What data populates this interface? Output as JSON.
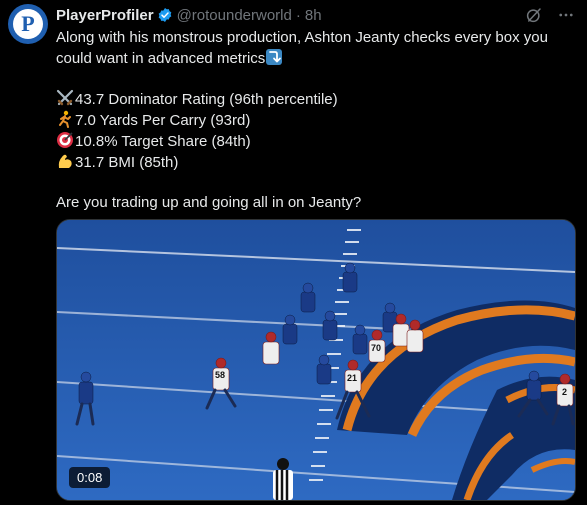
{
  "account": {
    "display_name": "PlayerProfiler",
    "handle": "@rotounderworld",
    "separator": "·",
    "time": "8h",
    "avatar_letter": "P"
  },
  "tweet": {
    "line1": "Along with his monstrous production, Ashton Jeanty checks every box you",
    "line2": "could want in advanced metrics",
    "stats": [
      {
        "emoji": "crossed-swords-icon",
        "text": "43.7 Dominator Rating (96th percentile)"
      },
      {
        "emoji": "runner-icon",
        "text": "7.0 Yards Per Carry (93rd)"
      },
      {
        "emoji": "direct-hit-icon",
        "text": "10.8% Target Share (84th)"
      },
      {
        "emoji": "flexed-biceps-icon",
        "text": "31.7 BMI (85th)"
      }
    ],
    "question": "Are you trading up and going all in on Jeanty?"
  },
  "media": {
    "duration": "0:08",
    "jerseys": [
      "58",
      "70",
      "21",
      "2"
    ]
  },
  "colors": {
    "background": "#000000",
    "text": "#e7e9ea",
    "secondary": "#71767b",
    "verified": "#1d9bf0",
    "field_blue": "#2b62b6",
    "logo_orange": "#e07a1f"
  }
}
